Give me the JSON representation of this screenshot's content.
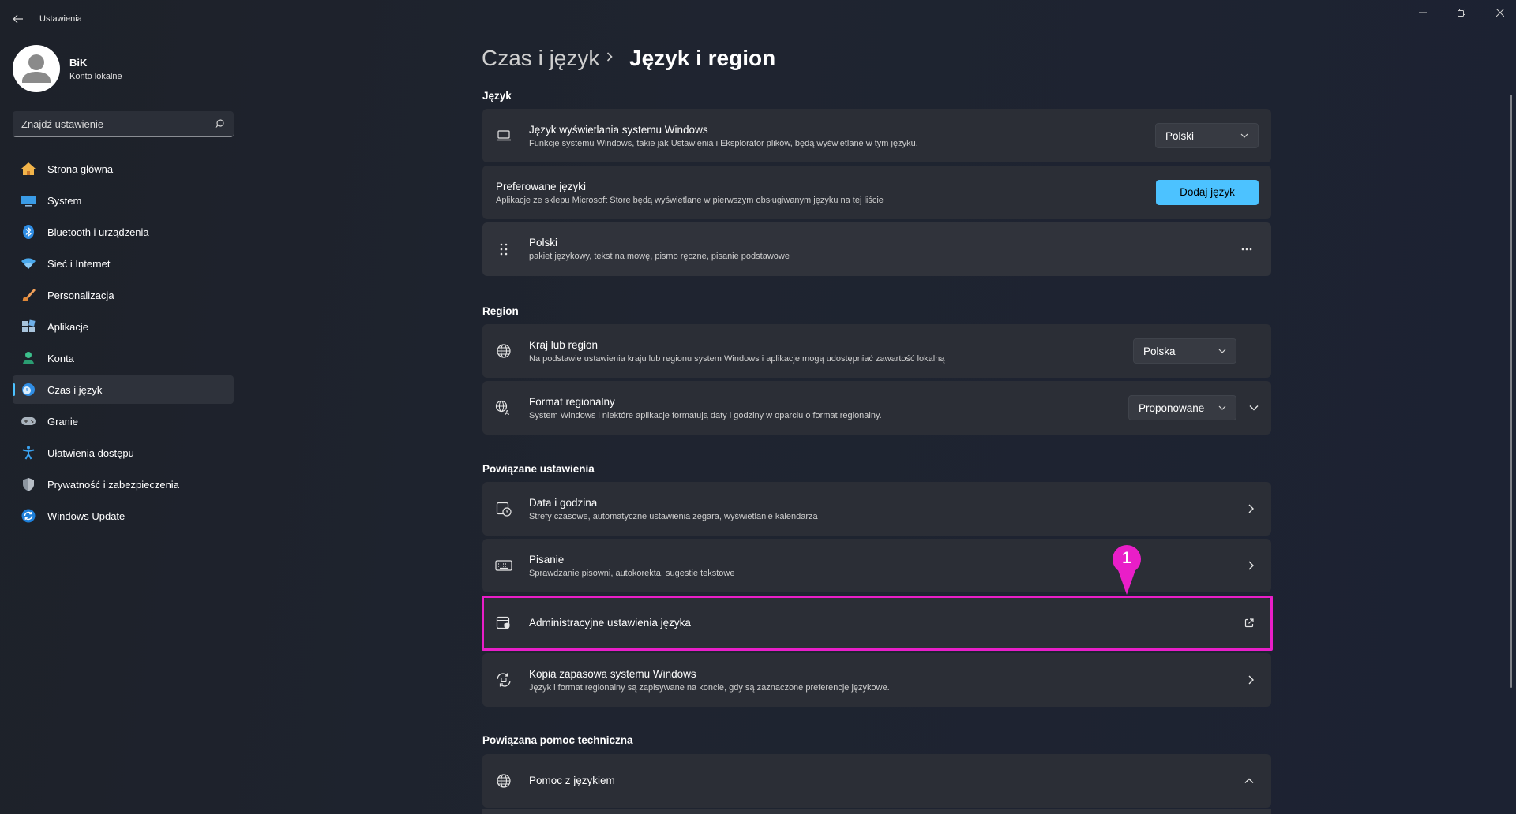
{
  "window": {
    "title": "Ustawienia",
    "controls": [
      "minimize",
      "maximize",
      "close"
    ]
  },
  "profile": {
    "name": "BiK",
    "account_type": "Konto lokalne"
  },
  "search": {
    "placeholder": "Znajdź ustawienie"
  },
  "sidebar": {
    "items": [
      {
        "label": "Strona główna",
        "icon": "home-icon"
      },
      {
        "label": "System",
        "icon": "monitor-icon"
      },
      {
        "label": "Bluetooth i urządzenia",
        "icon": "bluetooth-icon"
      },
      {
        "label": "Sieć i Internet",
        "icon": "wifi-icon"
      },
      {
        "label": "Personalizacja",
        "icon": "brush-icon"
      },
      {
        "label": "Aplikacje",
        "icon": "apps-icon"
      },
      {
        "label": "Konta",
        "icon": "person-icon"
      },
      {
        "label": "Czas i język",
        "icon": "clock-globe-icon",
        "active": true
      },
      {
        "label": "Granie",
        "icon": "gamepad-icon"
      },
      {
        "label": "Ułatwienia dostępu",
        "icon": "accessibility-icon"
      },
      {
        "label": "Prywatność i zabezpieczenia",
        "icon": "shield-icon"
      },
      {
        "label": "Windows Update",
        "icon": "update-icon"
      }
    ]
  },
  "breadcrumb": {
    "parent": "Czas i język",
    "current": "Język i region"
  },
  "sections": {
    "language": {
      "heading": "Język",
      "display_language": {
        "title": "Język wyświetlania systemu Windows",
        "subtitle": "Funkcje systemu Windows, takie jak Ustawienia i Eksplorator plików, będą wyświetlane w tym języku.",
        "value": "Polski"
      },
      "preferred": {
        "title": "Preferowane języki",
        "subtitle": "Aplikacje ze sklepu Microsoft Store będą wyświetlane w pierwszym obsługiwanym języku na tej liście",
        "button": "Dodaj język"
      },
      "polish": {
        "title": "Polski",
        "subtitle": "pakiet językowy, tekst na mowę, pismo ręczne, pisanie podstawowe",
        "more": "..."
      }
    },
    "region": {
      "heading": "Region",
      "country": {
        "title": "Kraj lub region",
        "subtitle": "Na podstawie ustawienia kraju lub regionu system Windows i aplikacje mogą udostępniać zawartość lokalną",
        "value": "Polska"
      },
      "format": {
        "title": "Format regionalny",
        "subtitle": "System Windows i niektóre aplikacje formatują daty i godziny w oparciu o format regionalny.",
        "value": "Proponowane"
      }
    },
    "related": {
      "heading": "Powiązane ustawienia",
      "date_time": {
        "title": "Data i godzina",
        "subtitle": "Strefy czasowe, automatyczne ustawienia zegara, wyświetlanie kalendarza"
      },
      "typing": {
        "title": "Pisanie",
        "subtitle": "Sprawdzanie pisowni, autokorekta, sugestie tekstowe"
      },
      "admin": {
        "title": "Administracyjne ustawienia języka"
      },
      "backup": {
        "title": "Kopia zapasowa systemu Windows",
        "subtitle": "Język i format regionalny są zapisywane na koncie, gdy są zaznaczone preferencje językowe."
      }
    },
    "support": {
      "heading": "Powiązana pomoc techniczna",
      "help": {
        "title": "Pomoc z językiem"
      }
    }
  },
  "annotation": {
    "number": "1",
    "color": "#e91ec8"
  },
  "colors": {
    "accent": "#4cc2ff",
    "card": "#2b2e36",
    "background": "#1f2430",
    "highlight": "#e91ec8"
  }
}
